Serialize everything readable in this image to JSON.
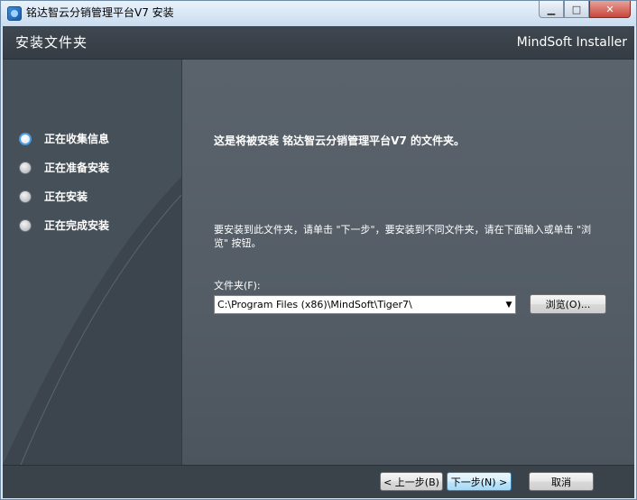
{
  "window": {
    "title": "铭达智云分销管理平台V7 安装",
    "controls": {
      "minimize": "▁",
      "maximize": "□",
      "close": "✕"
    }
  },
  "header": {
    "title": "安装文件夹",
    "brand": "MindSoft Installer"
  },
  "steps": [
    {
      "label": "正在收集信息",
      "active": true
    },
    {
      "label": "正在准备安装",
      "active": false
    },
    {
      "label": "正在安装",
      "active": false
    },
    {
      "label": "正在完成安装",
      "active": false
    }
  ],
  "main": {
    "heading": "这是将被安装 铭达智云分销管理平台V7 的文件夹。",
    "description": "要安装到此文件夹，请单击 \"下一步\"，要安装到不同文件夹，请在下面输入或单击 \"浏览\" 按钮。",
    "folder_label": "文件夹(F):",
    "folder_path": "C:\\Program Files (x86)\\MindSoft\\Tiger7\\",
    "combo_arrow": "▼",
    "browse_label": "浏览(O)..."
  },
  "footer": {
    "back_label": "< 上一步(B)",
    "next_label": "下一步(N) >",
    "cancel_label": "取消"
  },
  "colors": {
    "header_bg": "#3c444c",
    "sidebar_bg": "#465059",
    "main_bg": "#575f68",
    "footer_bg": "#3a424a",
    "active_step_ring": "#4e9bde"
  }
}
